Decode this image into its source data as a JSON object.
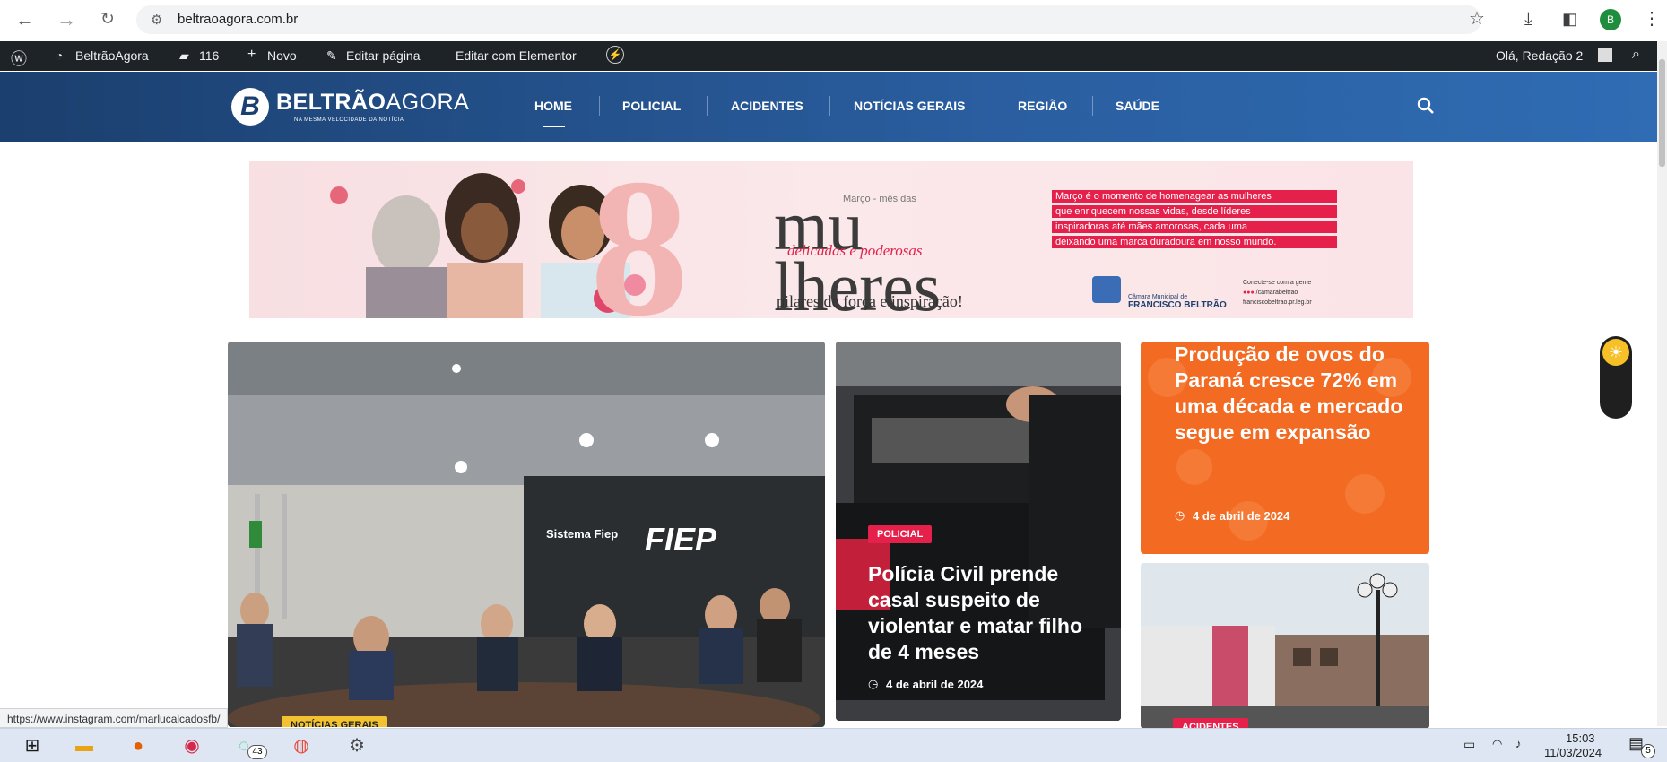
{
  "browser": {
    "url": "beltraoagora.com.br",
    "profile_initial": "B"
  },
  "adminbar": {
    "site_name": "BeltrãoAgora",
    "comments_count": "116",
    "new_label": "Novo",
    "edit_page_label": "Editar página",
    "edit_elementor_label": "Editar com Elementor",
    "greeting": "Olá, Redação 2"
  },
  "site": {
    "logo_name_bold": "BELTRÃO",
    "logo_name_light": "AGORA",
    "logo_tagline": "NA MESMA VELOCIDADE DA NOTÍCIA",
    "menu": [
      "HOME",
      "POLICIAL",
      "ACIDENTES",
      "NOTÍCIAS GERAIS",
      "REGIÃO",
      "SAÚDE"
    ]
  },
  "banner": {
    "month_label": "Março - mês das",
    "headline_1": "mu",
    "headline_2": "lheres",
    "script_text": "delicadas e poderosas",
    "subtitle": "pilares de força e inspiração!",
    "message_lines": [
      "Março é o momento de homenagear as mulheres",
      "que enriquecem nossas vidas, desde líderes",
      "inspiradoras até mães amorosas, cada uma",
      "deixando uma marca duradoura em nosso mundo."
    ],
    "council_line1": "Câmara Municipal de",
    "council_line2": "FRANCISCO BELTRÃO",
    "social_line1": "Conecte-se com a gente",
    "social_line2": "/camarabeltrao",
    "social_line3": "franciscobeltrao.pr.leg.br"
  },
  "posts": {
    "main_badge": "NOTÍCIAS GERAIS",
    "main_image_text": "Sistema Fiep",
    "main_image_logo": "FIEP",
    "police": {
      "badge": "POLICIAL",
      "title": "Polícia Civil prende casal suspeito de violentar e matar filho de 4 meses",
      "date": "4 de abril de 2024"
    },
    "eggs": {
      "title": "Produção de ovos do Paraná cresce 72% em uma década e mercado segue em expansão",
      "date": "4 de abril de 2024"
    },
    "accidents_badge": "ACIDENTES"
  },
  "status_url": "https://www.instagram.com/marlucalcadosfb/",
  "taskbar": {
    "whatsapp_count": "43",
    "time": "15:03",
    "date": "11/03/2024",
    "notif_count": "5"
  },
  "colors": {
    "brand_blue": "#1b3f6e",
    "accent_red": "#e5204b",
    "eggs_orange": "#f36a22"
  }
}
